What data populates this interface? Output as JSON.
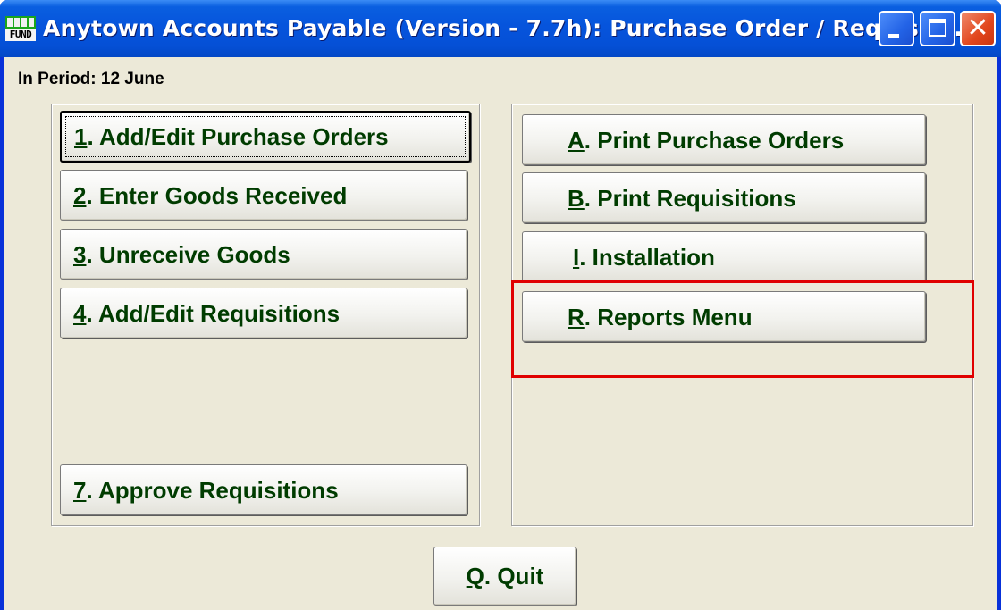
{
  "window": {
    "title": "Anytown Accounts Payable (Version - 7.7h):  Purchase Order / Requisiti...",
    "icon_text": "FUND",
    "icon_name": "fund-app-icon",
    "controls": {
      "minimize": "minimize-icon",
      "maximize": "maximize-icon",
      "close": "close-icon"
    }
  },
  "period_label": "In Period: 12 June",
  "left_menu": [
    {
      "key": "1",
      "rest": ".  Add/Edit Purchase Orders"
    },
    {
      "key": "2",
      "rest": ". Enter Goods Received"
    },
    {
      "key": "3",
      "rest": ". Unreceive Goods"
    },
    {
      "key": "4",
      "rest": ". Add/Edit Requisitions"
    },
    {
      "key": "7",
      "rest": ". Approve Requisitions"
    }
  ],
  "right_menu": [
    {
      "key": "A",
      "rest": ".  Print Purchase Orders"
    },
    {
      "key": "B",
      "rest": ". Print Requisitions"
    },
    {
      "key": "I",
      "rest": ".  Installation"
    },
    {
      "key": "R",
      "rest": ". Reports Menu"
    }
  ],
  "quit": {
    "key": "Q",
    "rest": ".  Quit"
  },
  "colors": {
    "titlebar": "#0550d6",
    "client": "#ece9d8",
    "button_text": "#003c00",
    "highlight": "#e00000"
  }
}
